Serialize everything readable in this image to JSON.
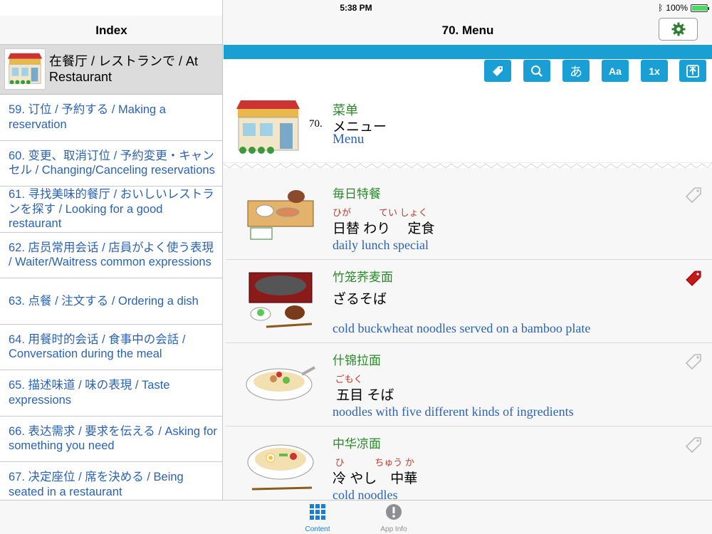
{
  "status": {
    "device": "iPad",
    "time": "5:38 PM",
    "battery": "100%",
    "battery_level": 1.0
  },
  "left": {
    "title": "Index",
    "section_title": "在餐厅 / レストランで / At Restaurant",
    "items": [
      "59. 订位 / 予約する / Making a reservation",
      "60. 变更、取消订位 / 予約変更・キャンセル / Changing/Canceling reservations",
      "61. 寻找美味的餐厅 / おいしいレストランを探す / Looking for a good restaurant",
      "62. 店员常用会话 / 店員がよく使う表現 / Waiter/Waitress common expressions",
      "63. 点餐 / 注文する / Ordering a dish",
      "64. 用餐时的会话 / 食事中の会話 / Conversation during the meal",
      "65. 描述味道 / 味の表現 / Taste expressions",
      "66. 表达需求 / 要求を伝える / Asking for something you need",
      "67. 决定座位 / 席を決める / Being seated in a restaurant"
    ]
  },
  "right": {
    "title": "70. Menu",
    "toolbar": {
      "font_kana": "あ",
      "font_size": "Aa",
      "speed": "1x"
    },
    "hero": {
      "num": "70.",
      "zh": "菜单",
      "ja": "メニュー",
      "en": "Menu"
    },
    "entries": [
      {
        "zh": "毎日特餐",
        "furi": "ひが　　　てい しょく",
        "ja": "日替 わり　 定食",
        "en": "daily lunch special",
        "tag_active": false
      },
      {
        "zh": "竹笼荞麦面",
        "furi": "",
        "ja": "ざるそば",
        "en": "cold buckwheat noodles served on a bamboo plate",
        "tag_active": true
      },
      {
        "zh": "什锦拉面",
        "furi": " ごもく",
        "ja": " 五目 そば",
        "en": "noodles with five different kinds of ingredients",
        "tag_active": false
      },
      {
        "zh": "中华凉面",
        "furi": " ひ　　　 ちゅう か",
        "ja": "冷 やし　中華",
        "en": "cold noodles",
        "tag_active": false
      }
    ]
  },
  "tabs": [
    {
      "label": "Content"
    },
    {
      "label": "App Info"
    }
  ],
  "colors": {
    "accent": "#1a9fd4",
    "link": "#2a63b5",
    "chinese": "#2a8a2a",
    "furigana": "#c0392b",
    "tab_active": "#1a7fd4"
  }
}
